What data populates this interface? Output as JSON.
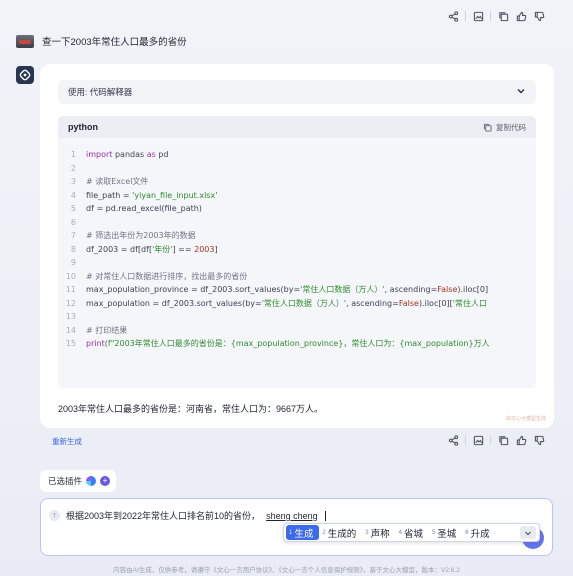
{
  "actions": {
    "top": [
      "share-icon",
      "image-export-icon",
      "copy-icon",
      "thumb-up-icon",
      "thumb-down-icon"
    ],
    "bottom": [
      "share-icon",
      "image-export-icon",
      "copy-icon",
      "thumb-up-icon",
      "thumb-down-icon"
    ]
  },
  "user_question": "查一下2003年常住人口最多的省份",
  "plugin_bar": {
    "label": "使用: 代码解释器"
  },
  "code": {
    "language": "python",
    "copy_label": "复制代码",
    "lines": [
      {
        "n": "1",
        "segs": [
          {
            "t": "import",
            "c": "kw"
          },
          {
            "t": " pandas ",
            "c": ""
          },
          {
            "t": "as",
            "c": "kw"
          },
          {
            "t": " pd",
            "c": ""
          }
        ]
      },
      {
        "n": "2",
        "segs": []
      },
      {
        "n": "3",
        "segs": [
          {
            "t": "# 读取Excel文件",
            "c": "cm"
          }
        ]
      },
      {
        "n": "4",
        "segs": [
          {
            "t": "file_path = ",
            "c": ""
          },
          {
            "t": "'yiyan_file_input.xlsx'",
            "c": "str"
          }
        ]
      },
      {
        "n": "5",
        "segs": [
          {
            "t": "df = pd.read_excel(file_path)",
            "c": ""
          }
        ]
      },
      {
        "n": "6",
        "segs": []
      },
      {
        "n": "7",
        "segs": [
          {
            "t": "# 筛选出年份为2003年的数据",
            "c": "cm"
          }
        ]
      },
      {
        "n": "8",
        "segs": [
          {
            "t": "df_2003 = df[df[",
            "c": ""
          },
          {
            "t": "'年份'",
            "c": "str"
          },
          {
            "t": "] == ",
            "c": ""
          },
          {
            "t": "2003",
            "c": "fn"
          },
          {
            "t": "]",
            "c": ""
          }
        ]
      },
      {
        "n": "9",
        "segs": []
      },
      {
        "n": "10",
        "segs": [
          {
            "t": "# 对常住人口数据进行排序，找出最多的省份",
            "c": "cm"
          }
        ]
      },
      {
        "n": "11",
        "segs": [
          {
            "t": "max_population_province = df_2003.sort_values(by=",
            "c": ""
          },
          {
            "t": "'常住人口数据（万人）'",
            "c": "str"
          },
          {
            "t": ", ascending=",
            "c": ""
          },
          {
            "t": "False",
            "c": "fn"
          },
          {
            "t": ").iloc[0]",
            "c": ""
          }
        ]
      },
      {
        "n": "12",
        "segs": [
          {
            "t": "max_population = df_2003.sort_values(by=",
            "c": ""
          },
          {
            "t": "'常住人口数据（万人）'",
            "c": "str"
          },
          {
            "t": ", ascending=",
            "c": ""
          },
          {
            "t": "False",
            "c": "fn"
          },
          {
            "t": ").iloc[0][",
            "c": ""
          },
          {
            "t": "'常住人口",
            "c": "str"
          }
        ]
      },
      {
        "n": "13",
        "segs": []
      },
      {
        "n": "14",
        "segs": [
          {
            "t": "# 打印结果",
            "c": "cm"
          }
        ]
      },
      {
        "n": "15",
        "segs": [
          {
            "t": "print",
            "c": "kw"
          },
          {
            "t": "(f\"2003年常住人口最多的省份是：{max_population_province}，常住人口为：{max_population}万人",
            "c": "str"
          }
        ]
      }
    ]
  },
  "result_text": "2003年常住人口最多的省份是：河南省，常住人口为：9667万人。",
  "ai_watermark": "由文心大模型生成",
  "regenerate_label": "重新生成",
  "plugins": {
    "label": "已选插件"
  },
  "input": {
    "text": "根据2003年到2022年常住人口排名前10的省份，",
    "composition": "sheng cheng"
  },
  "ime_candidates": [
    {
      "num": "1",
      "word": "生成",
      "selected": true
    },
    {
      "num": "2",
      "word": "生成的",
      "selected": false
    },
    {
      "num": "3",
      "word": "声称",
      "selected": false
    },
    {
      "num": "4",
      "word": "省城",
      "selected": false
    },
    {
      "num": "5",
      "word": "圣城",
      "selected": false
    },
    {
      "num": "6",
      "word": "升成",
      "selected": false
    }
  ],
  "footer": "内容由AI生成，仅供参考，请遵守《文心一言用户协议》、《文心一言个人信息保护规则》，基于文心大模型，版本：V2.6.2",
  "colors": {
    "accent": "#3b6be8",
    "send": "#6a6ff0"
  }
}
